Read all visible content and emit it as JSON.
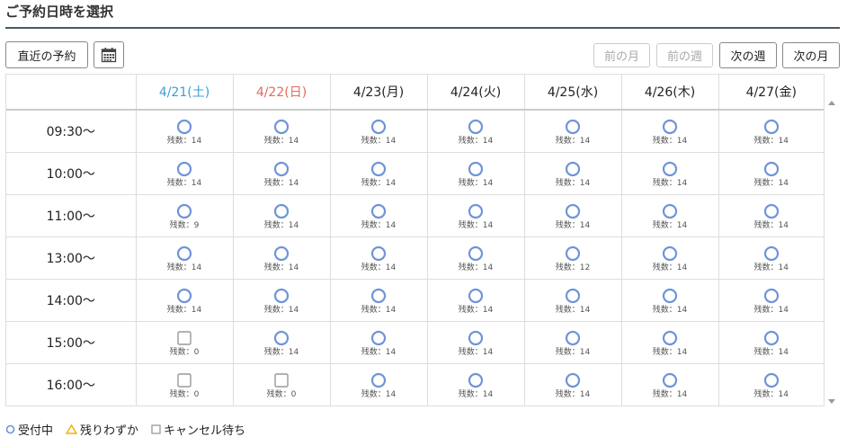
{
  "page": {
    "title": "ご予約日時を選択"
  },
  "toolbar": {
    "recent_label": "直近の予約",
    "calendar_icon": "calendar-icon",
    "prev_month_label": "前の月",
    "prev_week_label": "前の週",
    "next_week_label": "次の週",
    "next_month_label": "次の月"
  },
  "colors": {
    "available": "#6f94d8",
    "few_left": "#f0b400",
    "waitlist": "#999999",
    "saturday": "#3a9fd1",
    "sunday": "#e36a5c"
  },
  "calendar": {
    "days": [
      {
        "label": "4/21(土)",
        "type": "sat"
      },
      {
        "label": "4/22(日)",
        "type": "sun"
      },
      {
        "label": "4/23(月)",
        "type": "weekday"
      },
      {
        "label": "4/24(火)",
        "type": "weekday"
      },
      {
        "label": "4/25(水)",
        "type": "weekday"
      },
      {
        "label": "4/26(木)",
        "type": "weekday"
      },
      {
        "label": "4/27(金)",
        "type": "weekday"
      }
    ],
    "rows": [
      {
        "time": "09:30～",
        "slots": [
          {
            "status": "available",
            "remaining": "残数：14"
          },
          {
            "status": "available",
            "remaining": "残数：14"
          },
          {
            "status": "available",
            "remaining": "残数：14"
          },
          {
            "status": "available",
            "remaining": "残数：14"
          },
          {
            "status": "available",
            "remaining": "残数：14"
          },
          {
            "status": "available",
            "remaining": "残数：14"
          },
          {
            "status": "available",
            "remaining": "残数：14"
          }
        ]
      },
      {
        "time": "10:00～",
        "slots": [
          {
            "status": "available",
            "remaining": "残数：14"
          },
          {
            "status": "available",
            "remaining": "残数：14"
          },
          {
            "status": "available",
            "remaining": "残数：14"
          },
          {
            "status": "available",
            "remaining": "残数：14"
          },
          {
            "status": "available",
            "remaining": "残数：14"
          },
          {
            "status": "available",
            "remaining": "残数：14"
          },
          {
            "status": "available",
            "remaining": "残数：14"
          }
        ]
      },
      {
        "time": "11:00～",
        "slots": [
          {
            "status": "available",
            "remaining": "残数：9"
          },
          {
            "status": "available",
            "remaining": "残数：14"
          },
          {
            "status": "available",
            "remaining": "残数：14"
          },
          {
            "status": "available",
            "remaining": "残数：14"
          },
          {
            "status": "available",
            "remaining": "残数：14"
          },
          {
            "status": "available",
            "remaining": "残数：14"
          },
          {
            "status": "available",
            "remaining": "残数：14"
          }
        ]
      },
      {
        "time": "13:00～",
        "slots": [
          {
            "status": "available",
            "remaining": "残数：14"
          },
          {
            "status": "available",
            "remaining": "残数：14"
          },
          {
            "status": "available",
            "remaining": "残数：14"
          },
          {
            "status": "available",
            "remaining": "残数：14"
          },
          {
            "status": "available",
            "remaining": "残数：12"
          },
          {
            "status": "available",
            "remaining": "残数：14"
          },
          {
            "status": "available",
            "remaining": "残数：14"
          }
        ]
      },
      {
        "time": "14:00～",
        "slots": [
          {
            "status": "available",
            "remaining": "残数：14"
          },
          {
            "status": "available",
            "remaining": "残数：14"
          },
          {
            "status": "available",
            "remaining": "残数：14"
          },
          {
            "status": "available",
            "remaining": "残数：14"
          },
          {
            "status": "available",
            "remaining": "残数：14"
          },
          {
            "status": "available",
            "remaining": "残数：14"
          },
          {
            "status": "available",
            "remaining": "残数：14"
          }
        ]
      },
      {
        "time": "15:00～",
        "slots": [
          {
            "status": "waitlist",
            "remaining": "残数：0"
          },
          {
            "status": "available",
            "remaining": "残数：14"
          },
          {
            "status": "available",
            "remaining": "残数：14"
          },
          {
            "status": "available",
            "remaining": "残数：14"
          },
          {
            "status": "available",
            "remaining": "残数：14"
          },
          {
            "status": "available",
            "remaining": "残数：14"
          },
          {
            "status": "available",
            "remaining": "残数：14"
          }
        ]
      },
      {
        "time": "16:00～",
        "slots": [
          {
            "status": "waitlist",
            "remaining": "残数：0"
          },
          {
            "status": "waitlist",
            "remaining": "残数：0"
          },
          {
            "status": "available",
            "remaining": "残数：14"
          },
          {
            "status": "available",
            "remaining": "残数：14"
          },
          {
            "status": "available",
            "remaining": "残数：14"
          },
          {
            "status": "available",
            "remaining": "残数：14"
          },
          {
            "status": "available",
            "remaining": "残数：14"
          }
        ]
      }
    ]
  },
  "legend": {
    "available": "受付中",
    "few_left": "残りわずか",
    "waitlist": "キャンセル待ち"
  }
}
